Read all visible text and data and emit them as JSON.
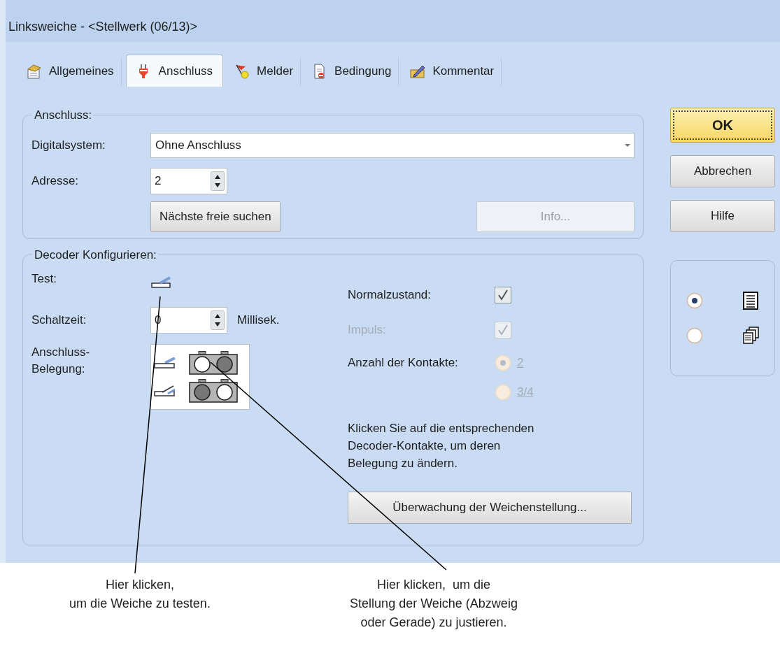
{
  "window": {
    "title": "Linksweiche - <Stellwerk (06/13)>"
  },
  "tabs": [
    {
      "label": "Allgemeines",
      "kind": "general",
      "selected": false
    },
    {
      "label": "Anschluss",
      "kind": "plug",
      "selected": true
    },
    {
      "label": "Melder",
      "kind": "flag",
      "selected": false
    },
    {
      "label": "Bedingung",
      "kind": "condition",
      "selected": false
    },
    {
      "label": "Kommentar",
      "kind": "comment",
      "selected": false
    }
  ],
  "anschluss_group": {
    "legend": "Anschluss:",
    "digitalsystem": {
      "label": "Digitalsystem:",
      "value": "Ohne Anschluss"
    },
    "adresse": {
      "label": "Adresse:",
      "value": "2"
    },
    "next_free_button": {
      "label": "Nächste freie suchen",
      "disabled": false
    },
    "info_button": {
      "label": "Info...",
      "disabled": true
    }
  },
  "decoder_group": {
    "legend": "Decoder Konfigurieren:",
    "test_label": "Test:",
    "schaltzeit": {
      "label": "Schaltzeit:",
      "value": "0",
      "unit": "Millisek."
    },
    "belegung": {
      "label": "Anschluss-\nBelegung:",
      "rows": [
        {
          "kind": "straight",
          "contacts": [
            {
              "white": true
            },
            {
              "white": false
            }
          ]
        },
        {
          "kind": "diverging",
          "contacts": [
            {
              "white": false
            },
            {
              "white": true
            }
          ]
        }
      ]
    },
    "normalzustand": {
      "label": "Normalzustand:",
      "checked": true,
      "disabled": false
    },
    "impuls": {
      "label": "Impuls:",
      "checked": true,
      "disabled": true
    },
    "kontakte": {
      "label": "Anzahl der Kontakte:",
      "options": [
        {
          "label": "2",
          "selected": true,
          "disabled": true
        },
        {
          "label": "3/4",
          "selected": false,
          "disabled": true
        }
      ]
    },
    "hint": "Klicken Sie auf die entsprechenden Decoder-Kontakte, um deren Belegung zu ändern.",
    "monitor_button": {
      "label": "Überwachung der Weichenstellung...",
      "disabled": false
    }
  },
  "buttons": [
    {
      "label": "OK",
      "kind": "default"
    },
    {
      "label": "Abbrechen",
      "kind": "normal"
    },
    {
      "label": "Hilfe",
      "kind": "normal"
    }
  ],
  "view_options": [
    {
      "kind": "list",
      "selected": true
    },
    {
      "kind": "pages",
      "selected": false
    }
  ],
  "annotations": [
    {
      "text": "Hier klicken,\num die Weiche zu testen."
    },
    {
      "text": "Hier klicken,  um die\nStellung der Weiche (Abzweig\noder Gerade) zu justieren."
    }
  ]
}
